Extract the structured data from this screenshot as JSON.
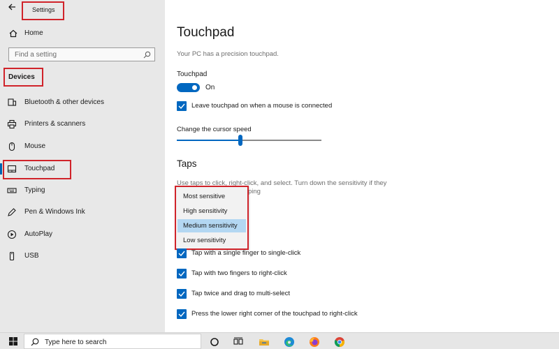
{
  "window": {
    "title": "Settings"
  },
  "sidebar": {
    "home_label": "Home",
    "search_placeholder": "Find a setting",
    "section_label": "Devices",
    "items": [
      {
        "label": "Bluetooth & other devices",
        "icon": "bluetooth-devices-icon"
      },
      {
        "label": "Printers & scanners",
        "icon": "printer-icon"
      },
      {
        "label": "Mouse",
        "icon": "mouse-icon"
      },
      {
        "label": "Touchpad",
        "icon": "touchpad-icon",
        "active": true
      },
      {
        "label": "Typing",
        "icon": "keyboard-icon"
      },
      {
        "label": "Pen & Windows Ink",
        "icon": "pen-icon"
      },
      {
        "label": "AutoPlay",
        "icon": "autoplay-icon"
      },
      {
        "label": "USB",
        "icon": "usb-icon"
      }
    ]
  },
  "main": {
    "title": "Touchpad",
    "subtitle": "Your PC has a precision touchpad.",
    "touchpad_label": "Touchpad",
    "toggle_state": "On",
    "toggle_on": true,
    "leave_on_label": "Leave touchpad on when a mouse is connected",
    "cursor_speed_label": "Change the cursor speed",
    "cursor_speed_fraction": 0.44,
    "taps_heading": "Taps",
    "taps_description_line1": "Use taps to click, right-click, and select. Turn down the sensitivity if they",
    "taps_description_line2": "ping",
    "sensitivity_options": [
      "Most sensitive",
      "High sensitivity",
      "Medium sensitivity",
      "Low sensitivity"
    ],
    "selected_sensitivity": "Medium sensitivity",
    "tap_options": [
      "Tap with a single finger to single-click",
      "Tap with two fingers to right-click",
      "Tap twice and drag to multi-select",
      "Press the lower right corner of the touchpad to right-click"
    ]
  },
  "taskbar": {
    "search_placeholder": "Type here to search",
    "icons": [
      "cortana-icon",
      "task-view-icon",
      "file-explorer-icon",
      "edge-icon",
      "firefox-icon",
      "chrome-icon"
    ]
  },
  "colors": {
    "accent": "#0067c0",
    "highlight_box": "#d0232a",
    "selected_option": "#b3d7f2"
  }
}
